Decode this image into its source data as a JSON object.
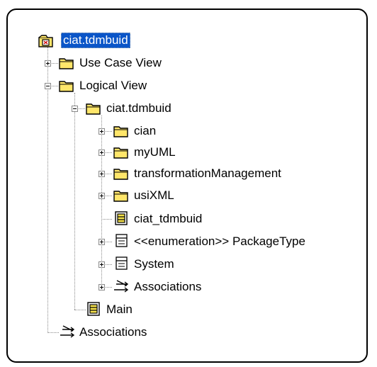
{
  "tree": {
    "root": {
      "label": "ciat.tdmbuid",
      "icon": "model-root-icon",
      "selected": true
    },
    "use_case_view": {
      "label": "Use Case View",
      "icon": "folder-icon",
      "expander": "+"
    },
    "logical_view": {
      "label": "Logical View",
      "icon": "folder-icon",
      "expander": "-"
    },
    "package_ciat": {
      "label": "ciat.tdmbuid",
      "icon": "folder-icon",
      "expander": "-"
    },
    "cian": {
      "label": "cian",
      "icon": "folder-icon",
      "expander": "+"
    },
    "myuml": {
      "label": "myUML",
      "icon": "folder-icon",
      "expander": "+"
    },
    "transformation": {
      "label": "transformationManagement",
      "icon": "folder-icon",
      "expander": "+"
    },
    "usixml": {
      "label": "usiXML",
      "icon": "folder-icon",
      "expander": "+"
    },
    "ciat_tdmbuid_diagram": {
      "label": "ciat_tdmbuid",
      "icon": "class-diagram-icon"
    },
    "package_type": {
      "label": "<<enumeration>> PackageType",
      "icon": "class-icon",
      "expander": "+"
    },
    "system": {
      "label": "System",
      "icon": "class-icon",
      "expander": "+"
    },
    "associations_inner": {
      "label": "Associations",
      "icon": "associations-icon",
      "expander": "+"
    },
    "main": {
      "label": "Main",
      "icon": "class-diagram-icon"
    },
    "associations_outer": {
      "label": "Associations",
      "icon": "associations-icon"
    }
  },
  "colors": {
    "selection": "#0a55c8",
    "folder": "#ffe66a",
    "diagram": "#f4e04a"
  }
}
